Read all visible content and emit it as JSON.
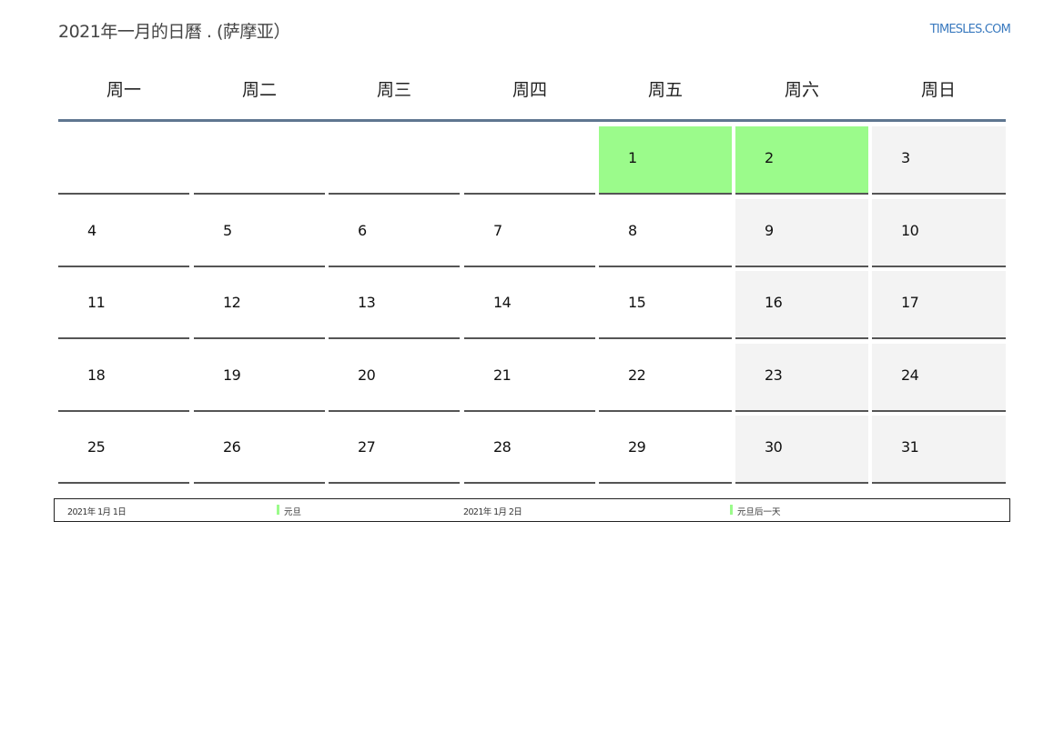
{
  "header": {
    "title": "2021年一月的日曆 . (萨摩亚）",
    "site": "TIMESLES.COM"
  },
  "weekdays": [
    "周一",
    "周二",
    "周三",
    "周四",
    "周五",
    "周六",
    "周日"
  ],
  "weeks": [
    [
      null,
      null,
      null,
      null,
      "1",
      "2",
      "3"
    ],
    [
      "4",
      "5",
      "6",
      "7",
      "8",
      "9",
      "10"
    ],
    [
      "11",
      "12",
      "13",
      "14",
      "15",
      "16",
      "17"
    ],
    [
      "18",
      "19",
      "20",
      "21",
      "22",
      "23",
      "24"
    ],
    [
      "25",
      "26",
      "27",
      "28",
      "29",
      "30",
      "31"
    ]
  ],
  "holiday_days": [
    "1",
    "2"
  ],
  "weekend_columns": [
    5,
    6
  ],
  "colors": {
    "holiday": "#9bfb8b",
    "weekend": "#f3f3f3",
    "header_rule": "#5f7690",
    "link": "#3a7abf"
  },
  "legend": [
    {
      "date": "2021年 1月 1日",
      "name": "元旦"
    },
    {
      "date": "2021年 1月 2日",
      "name": "元旦后一天"
    }
  ]
}
